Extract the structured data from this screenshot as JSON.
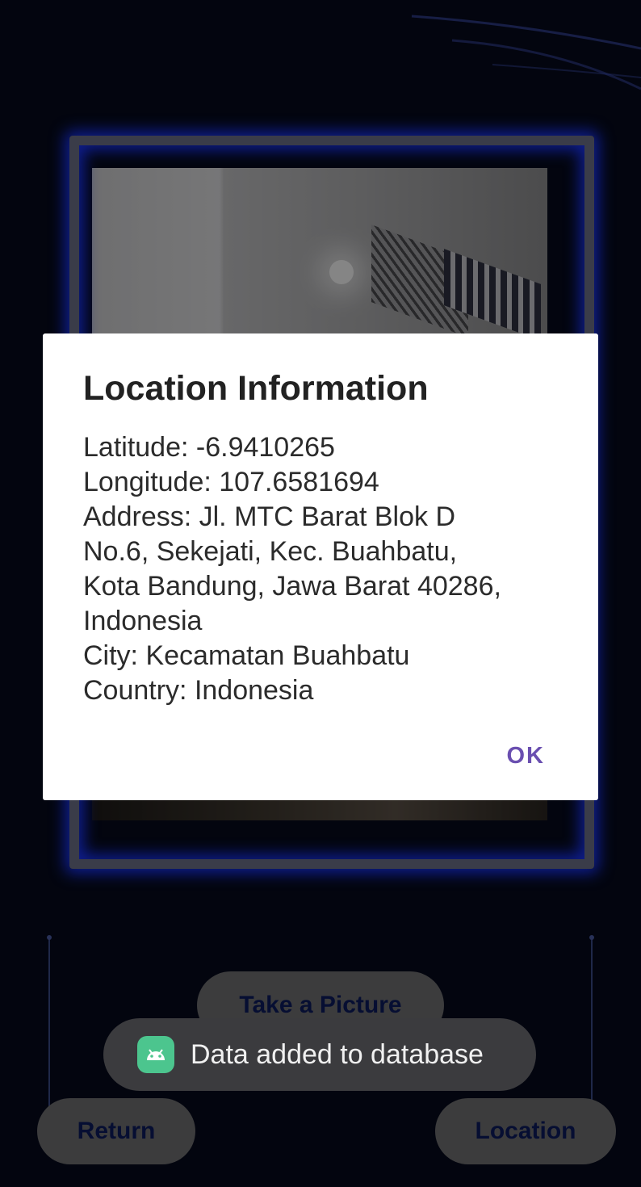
{
  "dialog": {
    "title": "Location Information",
    "body": "Latitude: -6.9410265\nLongitude: 107.6581694\nAddress: Jl. MTC Barat Blok D\nNo.6, Sekejati, Kec. Buahbatu,\nKota Bandung, Jawa Barat 40286,\nIndonesia\nCity: Kecamatan Buahbatu\nCountry: Indonesia",
    "ok_label": "OK"
  },
  "buttons": {
    "take_picture": "Take a Picture",
    "return": "Return",
    "location": "Location"
  },
  "toast": {
    "message": "Data added to database",
    "icon": "android-icon"
  },
  "colors": {
    "background": "#060a1c",
    "frame_glow": "#1a35ff",
    "ok_accent": "#6a4fb0",
    "button_text": "#0c1a5c",
    "toast_icon_bg": "#4cc58e"
  }
}
